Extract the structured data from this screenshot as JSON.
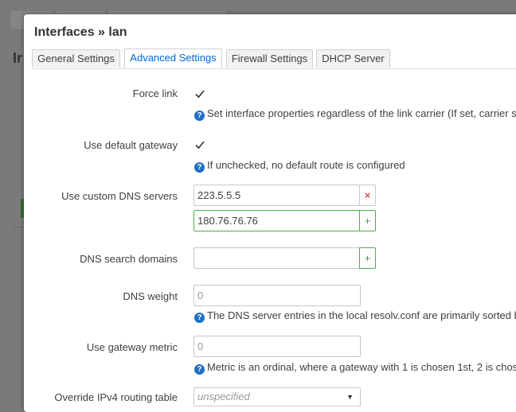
{
  "background": {
    "title_fragment": "Ir"
  },
  "modal": {
    "title": "Interfaces » lan",
    "tabs": [
      {
        "label": "General Settings",
        "active": false
      },
      {
        "label": "Advanced Settings",
        "active": true
      },
      {
        "label": "Firewall Settings",
        "active": false
      },
      {
        "label": "DHCP Server",
        "active": false
      }
    ]
  },
  "form": {
    "force_link": {
      "label": "Force link",
      "checked": true,
      "help": "Set interface properties regardless of the link carrier (If set, carrier s"
    },
    "use_default_gateway": {
      "label": "Use default gateway",
      "checked": true,
      "help": "If unchecked, no default route is configured"
    },
    "custom_dns": {
      "label": "Use custom DNS servers",
      "entries": [
        "223.5.5.5",
        "180.76.76.76"
      ],
      "remove_symbol": "×",
      "add_symbol": "+"
    },
    "dns_search": {
      "label": "DNS search domains",
      "value": "",
      "add_symbol": "+"
    },
    "dns_weight": {
      "label": "DNS weight",
      "placeholder": "0",
      "help": "The DNS server entries in the local resolv.conf are primarily sorted b"
    },
    "gateway_metric": {
      "label": "Use gateway metric",
      "placeholder": "0",
      "help": "Metric is an ordinal, where a gateway with 1 is chosen 1st, 2 is chos"
    },
    "ipv4_routing_table": {
      "label": "Override IPv4 routing table",
      "value": "unspecified"
    }
  },
  "colors": {
    "accent": "#0069d6",
    "help_icon": "#1f6fc5",
    "remove": "#d9534f",
    "add": "#4cae4c"
  }
}
